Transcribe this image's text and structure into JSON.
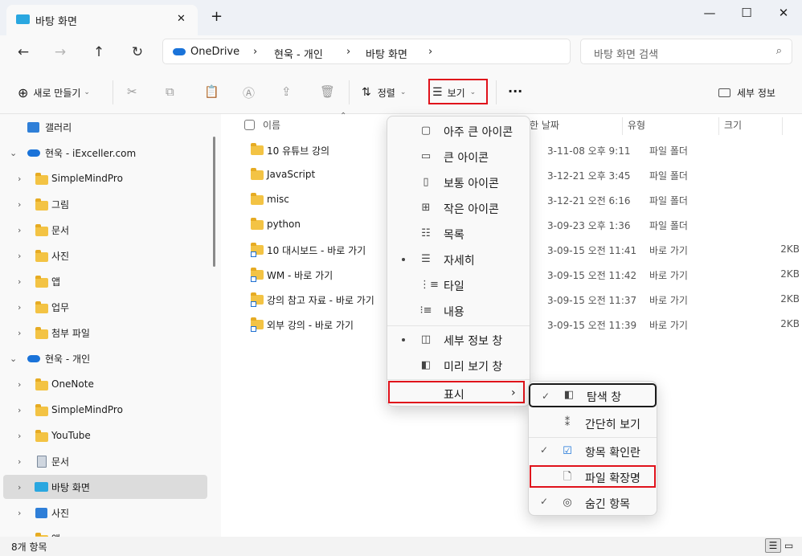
{
  "window": {
    "tab_title": "바탕 화면",
    "new_tab": "+",
    "tab_close": "✕",
    "minimize": "—",
    "maximize": "☐",
    "close": "✕"
  },
  "nav": {
    "back": "←",
    "forward": "→",
    "up": "↑",
    "refresh": "↻",
    "breadcrumb": [
      "OneDrive",
      "현욱 - 개인",
      "바탕 화면"
    ],
    "breadcrumb_sep": "›",
    "search_placeholder": "바탕 화면 검색"
  },
  "toolbar": {
    "new_label": "새로 만들기",
    "sort_label": "정렬",
    "view_label": "보기",
    "more_label": "···",
    "details_label": "세부 정보"
  },
  "sidebar": {
    "items": [
      {
        "label": "갤러리"
      },
      {
        "label": "현욱 - iExceller.com"
      },
      {
        "label": "SimpleMindPro"
      },
      {
        "label": "그림"
      },
      {
        "label": "문서"
      },
      {
        "label": "사진"
      },
      {
        "label": "앱"
      },
      {
        "label": "업무"
      },
      {
        "label": "첨부 파일"
      },
      {
        "label": "현욱 - 개인"
      },
      {
        "label": "OneNote"
      },
      {
        "label": "SimpleMindPro"
      },
      {
        "label": "YouTube"
      },
      {
        "label": "문서"
      },
      {
        "label": "바탕 화면"
      },
      {
        "label": "사진"
      },
      {
        "label": "앱"
      }
    ]
  },
  "columns": {
    "name": "이름",
    "date": "한 날짜",
    "type": "유형",
    "size": "크기"
  },
  "files": [
    {
      "name": "10 유튜브 강의",
      "date": "3-11-08 오후 9:11",
      "type": "파일 폴더",
      "size": ""
    },
    {
      "name": "JavaScript",
      "date": "3-12-21 오후 3:45",
      "type": "파일 폴더",
      "size": ""
    },
    {
      "name": "misc",
      "date": "3-12-21 오전 6:16",
      "type": "파일 폴더",
      "size": ""
    },
    {
      "name": "python",
      "date": "3-09-23 오후 1:36",
      "type": "파일 폴더",
      "size": ""
    },
    {
      "name": "10 대시보드 - 바로 가기",
      "date": "3-09-15 오전 11:41",
      "type": "바로 가기",
      "size": "2KB"
    },
    {
      "name": "WM - 바로 가기",
      "date": "3-09-15 오전 11:42",
      "type": "바로 가기",
      "size": "2KB"
    },
    {
      "name": "강의 참고 자료 - 바로 가기",
      "date": "3-09-15 오전 11:37",
      "type": "바로 가기",
      "size": "2KB"
    },
    {
      "name": "외부 강의 - 바로 가기",
      "date": "3-09-15 오전 11:39",
      "type": "바로 가기",
      "size": "2KB"
    }
  ],
  "view_menu": {
    "items": [
      {
        "label": "아주 큰 아이콘"
      },
      {
        "label": "큰 아이콘"
      },
      {
        "label": "보통 아이콘"
      },
      {
        "label": "작은 아이콘"
      },
      {
        "label": "목록"
      },
      {
        "label": "자세히"
      },
      {
        "label": "타일"
      },
      {
        "label": "내용"
      },
      {
        "label": "세부 정보 창"
      },
      {
        "label": "미리 보기 창"
      },
      {
        "label": "표시"
      }
    ],
    "show_arrow": "›"
  },
  "show_submenu": {
    "items": [
      {
        "label": "탐색 창"
      },
      {
        "label": "간단히 보기"
      },
      {
        "label": "항목 확인란"
      },
      {
        "label": "파일 확장명"
      },
      {
        "label": "숨긴 항목"
      }
    ],
    "check": "✓"
  },
  "status": {
    "item_count": "8개 항목"
  },
  "colors": {
    "highlight": "#e0121b",
    "folder": "#f3c344",
    "accent": "#1a73d9"
  }
}
